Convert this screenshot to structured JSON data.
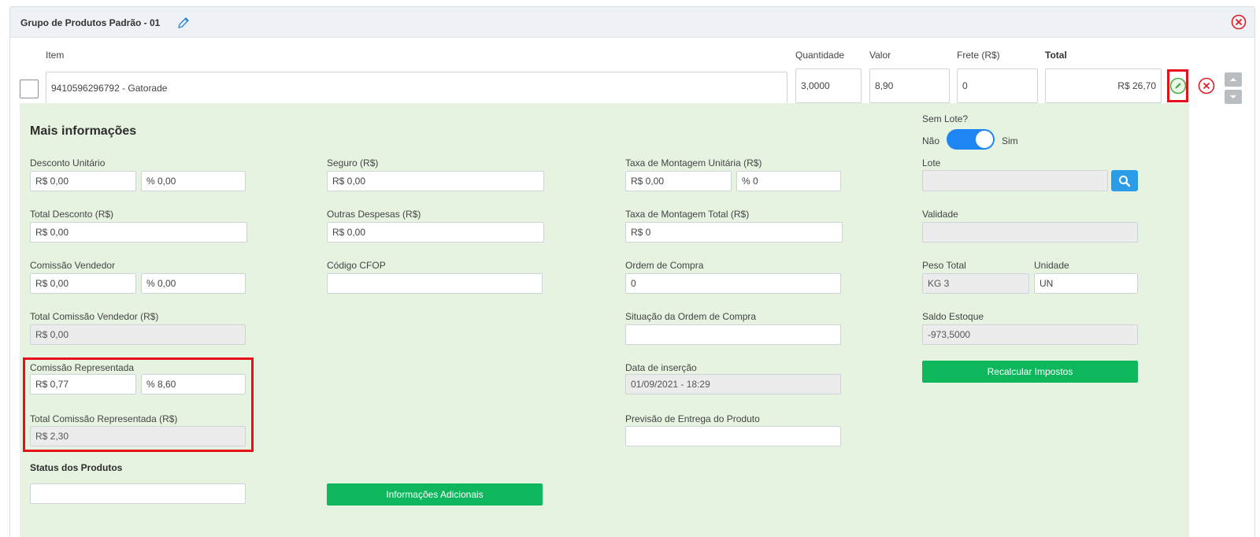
{
  "group": {
    "title": "Grupo de Produtos Padrão - 01"
  },
  "columns": {
    "item": "Item",
    "quantity": "Quantidade",
    "value": "Valor",
    "freight": "Frete (R$)",
    "total": "Total"
  },
  "row": {
    "item": "9410596296792 - Gatorade",
    "quantity": "3,0000",
    "value": "8,90",
    "freight": "0",
    "total": "R$ 26,70"
  },
  "panel": {
    "title": "Mais informações",
    "sem_lote": {
      "label": "Sem Lote?",
      "off": "Não",
      "on": "Sim",
      "checked": true
    },
    "desconto_unitario": {
      "label": "Desconto Unitário",
      "value": "R$ 0,00",
      "percent": "% 0,00"
    },
    "total_desconto": {
      "label": "Total Desconto (R$)",
      "value": "R$ 0,00"
    },
    "comissao_vendedor": {
      "label": "Comissão Vendedor",
      "value": "R$ 0,00",
      "percent": "% 0,00"
    },
    "total_comissao_vendedor": {
      "label": "Total Comissão Vendedor (R$)",
      "value": "R$ 0,00"
    },
    "comissao_representada": {
      "label": "Comissão Representada",
      "value": "R$ 0,77",
      "percent": "% 8,60"
    },
    "total_comissao_representada": {
      "label": "Total Comissão Representada (R$)",
      "value": "R$ 2,30"
    },
    "status_produtos": {
      "label": "Status dos Produtos",
      "value": ""
    },
    "seguro": {
      "label": "Seguro (R$)",
      "value": "R$ 0,00"
    },
    "outras_despesas": {
      "label": "Outras Despesas (R$)",
      "value": "R$ 0,00"
    },
    "codigo_cfop": {
      "label": "Código CFOP",
      "value": ""
    },
    "info_adicionais_button": "Informações Adicionais",
    "taxa_montagem_unitaria": {
      "label": "Taxa de Montagem Unitária (R$)",
      "value": "R$ 0,00",
      "percent": "% 0"
    },
    "taxa_montagem_total": {
      "label": "Taxa de Montagem Total (R$)",
      "value": "R$ 0"
    },
    "ordem_compra": {
      "label": "Ordem de Compra",
      "value": "0"
    },
    "situacao_ordem_compra": {
      "label": "Situação da Ordem de Compra",
      "value": ""
    },
    "data_insercao": {
      "label": "Data de inserção",
      "value": "01/09/2021 - 18:29"
    },
    "previsao_entrega": {
      "label": "Previsão de Entrega do Produto",
      "value": ""
    },
    "lote": {
      "label": "Lote",
      "value": ""
    },
    "validade": {
      "label": "Validade",
      "value": ""
    },
    "peso_total": {
      "label": "Peso Total",
      "value": "KG 3"
    },
    "unidade": {
      "label": "Unidade",
      "value": "UN"
    },
    "saldo_estoque": {
      "label": "Saldo Estoque",
      "value": "-973,5000"
    },
    "recalcular_button": "Recalcular Impostos"
  },
  "colors": {
    "panel_bg": "#e6f3e1",
    "accent_green": "#0fb75c",
    "highlight_red": "#e6101a",
    "toggle_blue": "#1d86f2"
  },
  "icons": [
    "pencil-icon",
    "close-circle-icon",
    "edit-circle-icon",
    "remove-circle-icon",
    "search-icon",
    "caret-up-icon",
    "caret-down-icon"
  ]
}
